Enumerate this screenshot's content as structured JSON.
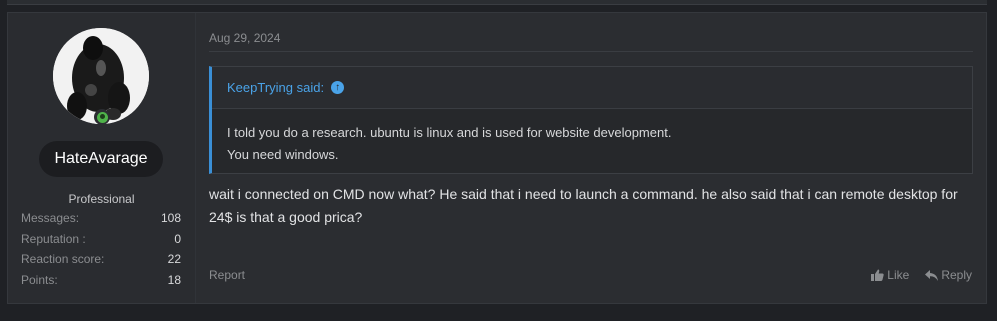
{
  "post": {
    "author": {
      "username": "HateAvarage",
      "title": "Professional",
      "stats": [
        {
          "label": "Messages:",
          "value": "108"
        },
        {
          "label": "Reputation :",
          "value": "0"
        },
        {
          "label": "Reaction score:",
          "value": "22"
        },
        {
          "label": "Points:",
          "value": "18"
        }
      ],
      "online": true
    },
    "date": "Aug 29, 2024",
    "quote": {
      "author_said": "KeepTrying said:",
      "lines": [
        "I told you do a research. ubuntu is linux and is used for website development.",
        "You need windows."
      ]
    },
    "message": "wait i connected on CMD now what? He said that i need to launch a command. he also said that i can remote desktop for 24$ is that a good prica?",
    "actions": {
      "report": "Report",
      "like": "Like",
      "reply": "Reply"
    }
  },
  "icons": {
    "online": "online-status-icon",
    "quote_jump": "arrow-up-circle-icon",
    "like": "thumbs-up-icon",
    "reply": "reply-arrow-icon"
  },
  "colors": {
    "accent": "#4aa3e8",
    "online": "#4fb34a"
  }
}
